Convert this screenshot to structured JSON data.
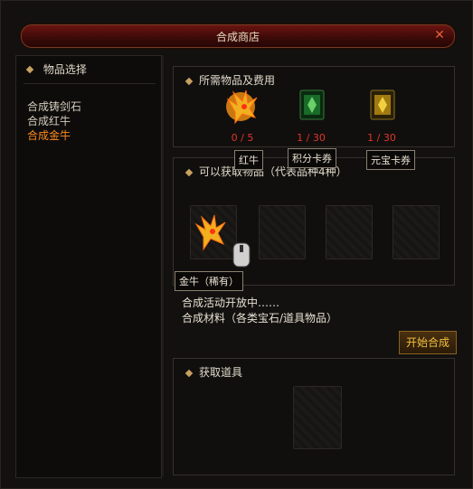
{
  "window": {
    "title": "合成商店",
    "close_icon": "close-icon"
  },
  "sidebar": {
    "header": "物品选择",
    "items": [
      "合成铸剑石",
      "合成红牛",
      "合成金牛"
    ],
    "active_index": 2
  },
  "cost_panel": {
    "header": "所需物品及费用",
    "items": [
      {
        "name": "红牛",
        "count": "0 / 5",
        "icon": "golden-dragon-icon"
      },
      {
        "name": "积分卡券",
        "count": "1 / 30",
        "icon": "green-card-icon"
      },
      {
        "name": "元宝卡券",
        "count": "1 / 30",
        "icon": "gold-card-icon"
      }
    ]
  },
  "result_panel": {
    "header": "可以获取物品（代表品种4种）",
    "first_item_tip": "金牛（稀有）"
  },
  "info": {
    "line1": "合成活动开放中……",
    "line2": "合成材料（各类宝石/道具物品）"
  },
  "actions": {
    "start_label": "开始合成"
  },
  "obtain_panel": {
    "header": "获取道具"
  },
  "colors": {
    "accent": "#ff8a1a",
    "count_red": "#e0362a",
    "button_text": "#f0c040"
  }
}
